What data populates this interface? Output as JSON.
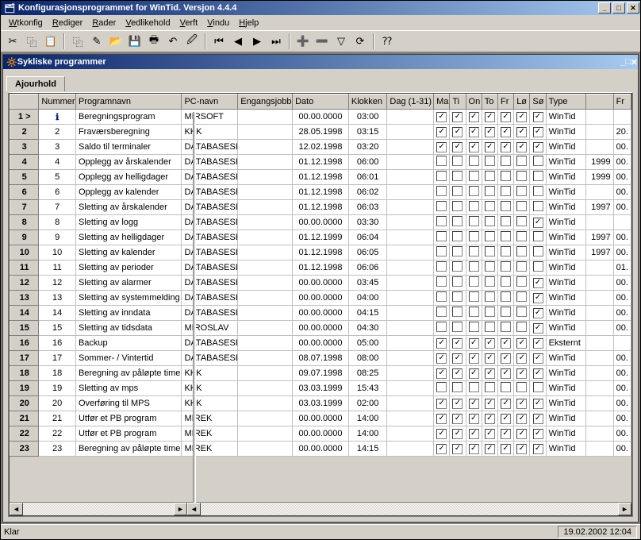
{
  "window": {
    "title": "Konfigurasjonsprogrammet for WinTid. Versjon 4.4.4"
  },
  "menus": [
    {
      "label": "Wtkonfig",
      "u": "W"
    },
    {
      "label": "Rediger",
      "u": "R"
    },
    {
      "label": "Rader",
      "u": "R"
    },
    {
      "label": "Vedlikehold",
      "u": "V"
    },
    {
      "label": "Verft",
      "u": "V"
    },
    {
      "label": "Vindu",
      "u": "V"
    },
    {
      "label": "Hjelp",
      "u": "H"
    }
  ],
  "child": {
    "title": "Sykliske programmer",
    "tab": "Ajourhold"
  },
  "cols": [
    "",
    "Nummer",
    "Programnavn",
    "PC-navn",
    "Engangsjobb",
    "Dato",
    "Klokken",
    "Dag (1-31)",
    "Ma",
    "Ti",
    "On",
    "To",
    "Fr",
    "Lø",
    "Sø",
    "Type",
    "",
    "Fr"
  ],
  "rows": [
    {
      "n": 1,
      "rowmark": ">",
      "ico": true,
      "name": "Beregningsprogram",
      "pc": "MIRSOFT",
      "eng": "",
      "dato": "00.00.0000",
      "klokken": "03:00",
      "dag": "",
      "days": [
        1,
        1,
        1,
        1,
        1,
        1,
        1
      ],
      "type": "WinTid",
      "c": "",
      "f": ""
    },
    {
      "n": 2,
      "name": "Fraværsberegning",
      "pc": "KKK",
      "eng": "",
      "dato": "28.05.1998",
      "klokken": "03:15",
      "dag": "",
      "days": [
        1,
        1,
        1,
        1,
        1,
        1,
        1
      ],
      "type": "WinTid",
      "c": "",
      "f": "20."
    },
    {
      "n": 3,
      "name": "Saldo til terminaler",
      "pc": "DATABASESE",
      "eng": "",
      "dato": "12.02.1998",
      "klokken": "03:20",
      "dag": "",
      "days": [
        1,
        1,
        1,
        1,
        1,
        1,
        1
      ],
      "type": "WinTid",
      "c": "",
      "f": "00."
    },
    {
      "n": 4,
      "name": "Opplegg av årskalender",
      "pc": "DATABASESE",
      "eng": "",
      "dato": "01.12.1998",
      "klokken": "06:00",
      "dag": "",
      "days": [
        0,
        0,
        0,
        0,
        0,
        0,
        0
      ],
      "type": "WinTid",
      "c": "1999",
      "f": "00."
    },
    {
      "n": 5,
      "name": "Opplegg av helligdager",
      "pc": "DATABASESE",
      "eng": "",
      "dato": "01.12.1998",
      "klokken": "06:01",
      "dag": "",
      "days": [
        0,
        0,
        0,
        0,
        0,
        0,
        0
      ],
      "type": "WinTid",
      "c": "1999",
      "f": "00."
    },
    {
      "n": 6,
      "name": "Opplegg av kalender",
      "pc": "DATABASESE",
      "eng": "",
      "dato": "01.12.1998",
      "klokken": "06:02",
      "dag": "",
      "days": [
        0,
        0,
        0,
        0,
        0,
        0,
        0
      ],
      "type": "WinTid",
      "c": "",
      "f": "00."
    },
    {
      "n": 7,
      "name": "Sletting av årskalender",
      "pc": "DATABASESE",
      "eng": "",
      "dato": "01.12.1998",
      "klokken": "06:03",
      "dag": "",
      "days": [
        0,
        0,
        0,
        0,
        0,
        0,
        0
      ],
      "type": "WinTid",
      "c": "1997",
      "f": "00."
    },
    {
      "n": 8,
      "name": "Sletting av logg",
      "pc": "DATABASESE",
      "eng": "",
      "dato": "00.00.0000",
      "klokken": "03:30",
      "dag": "",
      "days": [
        0,
        0,
        0,
        0,
        0,
        0,
        1
      ],
      "type": "WinTid",
      "c": "",
      "f": ""
    },
    {
      "n": 9,
      "name": "Sletting av helligdager",
      "pc": "DATABASESE",
      "eng": "",
      "dato": "01.12.1999",
      "klokken": "06:04",
      "dag": "",
      "days": [
        0,
        0,
        0,
        0,
        0,
        0,
        0
      ],
      "type": "WinTid",
      "c": "1997",
      "f": "00."
    },
    {
      "n": 10,
      "name": "Sletting av kalender",
      "pc": "DATABASESE",
      "eng": "",
      "dato": "01.12.1998",
      "klokken": "06:05",
      "dag": "",
      "days": [
        0,
        0,
        0,
        0,
        0,
        0,
        0
      ],
      "type": "WinTid",
      "c": "1997",
      "f": "00."
    },
    {
      "n": 11,
      "name": "Sletting av perioder",
      "pc": "DATABASESE",
      "eng": "",
      "dato": "01.12.1998",
      "klokken": "06:06",
      "dag": "",
      "days": [
        0,
        0,
        0,
        0,
        0,
        0,
        0
      ],
      "type": "WinTid",
      "c": "",
      "f": "01."
    },
    {
      "n": 12,
      "name": "Sletting av alarmer",
      "pc": "DATABASESE",
      "eng": "",
      "dato": "00.00.0000",
      "klokken": "03:45",
      "dag": "",
      "days": [
        0,
        0,
        0,
        0,
        0,
        0,
        1
      ],
      "type": "WinTid",
      "c": "",
      "f": "00."
    },
    {
      "n": 13,
      "name": "Sletting av systemmelding",
      "pc": "DATABASESE",
      "eng": "",
      "dato": "00.00.0000",
      "klokken": "04:00",
      "dag": "",
      "days": [
        0,
        0,
        0,
        0,
        0,
        0,
        1
      ],
      "type": "WinTid",
      "c": "",
      "f": "00."
    },
    {
      "n": 14,
      "name": "Sletting av inndata",
      "pc": "DATABASESE",
      "eng": "",
      "dato": "00.00.0000",
      "klokken": "04:15",
      "dag": "",
      "days": [
        0,
        0,
        0,
        0,
        0,
        0,
        1
      ],
      "type": "WinTid",
      "c": "",
      "f": "00."
    },
    {
      "n": 15,
      "name": "Sletting av tidsdata",
      "pc": "MIROSLAV",
      "eng": "",
      "dato": "00.00.0000",
      "klokken": "04:30",
      "dag": "",
      "days": [
        0,
        0,
        0,
        0,
        0,
        0,
        1
      ],
      "type": "WinTid",
      "c": "",
      "f": "00."
    },
    {
      "n": 16,
      "name": "Backup",
      "pc": "DATABASESE",
      "eng": "",
      "dato": "00.00.0000",
      "klokken": "05:00",
      "dag": "",
      "days": [
        1,
        1,
        1,
        1,
        1,
        1,
        1
      ],
      "type": "Eksternt",
      "c": "",
      "f": ""
    },
    {
      "n": 17,
      "name": "Sommer- / Vintertid",
      "pc": "DATABASESE",
      "eng": "",
      "dato": "08.07.1998",
      "klokken": "08:00",
      "dag": "",
      "days": [
        1,
        1,
        1,
        1,
        1,
        1,
        1
      ],
      "type": "WinTid",
      "c": "",
      "f": "00."
    },
    {
      "n": 18,
      "name": "Beregning av påløpte timer",
      "pc": "KKK",
      "eng": "",
      "dato": "09.07.1998",
      "klokken": "08:25",
      "dag": "",
      "days": [
        1,
        1,
        1,
        1,
        1,
        1,
        1
      ],
      "type": "WinTid",
      "c": "",
      "f": "00."
    },
    {
      "n": 19,
      "name": "Sletting av mps",
      "pc": "KKK",
      "eng": "",
      "dato": "03.03.1999",
      "klokken": "15:43",
      "dag": "",
      "days": [
        0,
        0,
        0,
        0,
        0,
        0,
        0
      ],
      "type": "WinTid",
      "c": "",
      "f": "00."
    },
    {
      "n": 20,
      "name": "Overføring til MPS",
      "pc": "KKK",
      "eng": "",
      "dato": "03.03.1999",
      "klokken": "02:00",
      "dag": "",
      "days": [
        1,
        1,
        1,
        1,
        1,
        1,
        1
      ],
      "type": "WinTid",
      "c": "",
      "f": "00."
    },
    {
      "n": 21,
      "name": "Utfør et PB program",
      "pc": "MIREK",
      "eng": "",
      "dato": "00.00.0000",
      "klokken": "14:00",
      "dag": "",
      "days": [
        1,
        1,
        1,
        1,
        1,
        1,
        1
      ],
      "type": "WinTid",
      "c": "",
      "f": "00."
    },
    {
      "n": 22,
      "name": "Utfør et PB program",
      "pc": "MIREK",
      "eng": "",
      "dato": "00.00.0000",
      "klokken": "14:00",
      "dag": "",
      "days": [
        1,
        1,
        1,
        1,
        1,
        1,
        1
      ],
      "type": "WinTid",
      "c": "",
      "f": "00."
    },
    {
      "n": 23,
      "name": "Beregning av påløpte timer",
      "pc": "MIREK",
      "eng": "",
      "dato": "00.00.0000",
      "klokken": "14:15",
      "dag": "",
      "days": [
        1,
        1,
        1,
        1,
        1,
        1,
        1
      ],
      "type": "WinTid",
      "c": "",
      "f": "00."
    }
  ],
  "status": {
    "left": "Klar",
    "right": "19.02.2002 12:04"
  },
  "toolbar_icons": [
    "cut",
    "copy",
    "paste",
    "copyrow",
    "new",
    "open",
    "save",
    "print",
    "undo",
    "redo",
    "first",
    "prev",
    "next",
    "last",
    "insert",
    "delete",
    "filter",
    "refresh",
    "help"
  ]
}
